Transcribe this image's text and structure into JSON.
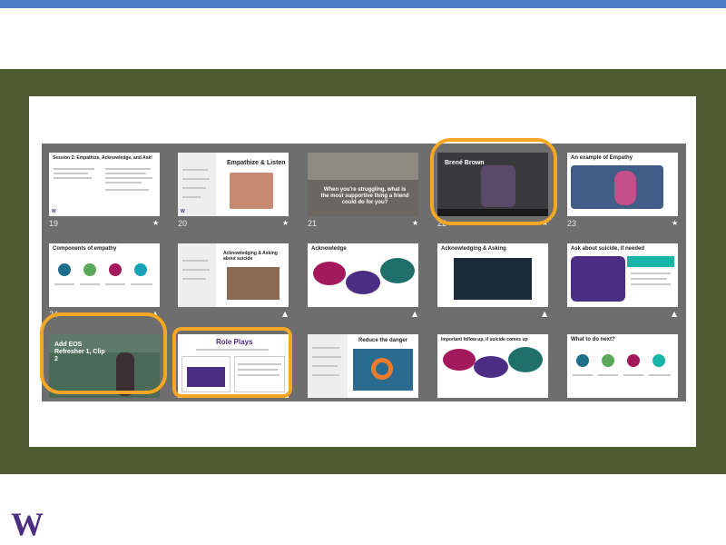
{
  "logo": "W",
  "colors": {
    "accent_bar": "#4d7cc4",
    "background_green": "#4e5a30",
    "highlight": "#f5a623",
    "brand_purple": "#4b2e83"
  },
  "slides": [
    {
      "number": "19",
      "title": "Session 2: Empathize, Acknowledge, and Ask!",
      "starred": true
    },
    {
      "number": "20",
      "title": "Empathize & Listen",
      "starred": true
    },
    {
      "number": "21",
      "title": "When you're struggling, what is the most supportive thing a friend could do for you?",
      "starred": true
    },
    {
      "number": "22",
      "title": "Brené Brown",
      "starred": true
    },
    {
      "number": "23",
      "title": "An example of Empathy",
      "starred": true
    },
    {
      "number": "24",
      "title": "Components of empathy",
      "starred": false
    },
    {
      "number": "25",
      "title": "Acknowledging & Asking about suicide",
      "starred": false
    },
    {
      "number": "26",
      "title": "Acknowledge",
      "starred": false
    },
    {
      "number": "27",
      "title": "Acknowledging & Asking",
      "starred": false
    },
    {
      "number": "28",
      "title": "Ask about suicide, if needed",
      "starred": false
    },
    {
      "number": "",
      "title": "Add EOS Refresher 1, Clip 2",
      "starred": false
    },
    {
      "number": "",
      "title": "Role Plays",
      "starred": false
    },
    {
      "number": "",
      "title": "Reduce the danger",
      "starred": false
    },
    {
      "number": "",
      "title": "Important follow up, if suicide comes up",
      "starred": false
    },
    {
      "number": "",
      "title": "What to do next?",
      "starred": false
    }
  ],
  "star_glyph": "★",
  "mark_glyph": "▲"
}
